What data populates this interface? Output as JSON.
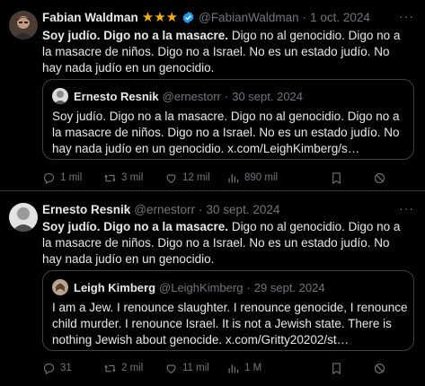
{
  "posts": [
    {
      "author_name": "Fabian Waldman",
      "stars": "★★★",
      "handle": "@FabianWaldman",
      "separator": "·",
      "date": "1 oct. 2024",
      "more": "···",
      "text_bold": "Soy judío. Digo no a la masacre.",
      "text_rest": " Digo no al genocidio. Digo no a la masacre de niños. Digo no a Israel. No es un estado judío. No hay nada judío en un genocidio.",
      "quote": {
        "author_name": "Ernesto Resnik",
        "handle": "@ernestorr",
        "separator": "·",
        "date": "30 sept. 2024",
        "text": "Soy judío. Digo no a la masacre. Digo no al genocidio. Digo no a la masacre de niños. Digo no a Israel. No es un estado judío. No hay nada judío en un genocidio. x.com/LeighKimberg/s…"
      },
      "actions": {
        "replies": "1 mil",
        "reposts": "3 mil",
        "likes": "12 mil",
        "views": "890 mil"
      }
    },
    {
      "author_name": "Ernesto Resnik",
      "handle": "@ernestorr",
      "separator": "·",
      "date": "30 sept. 2024",
      "more": "···",
      "text_bold": "Soy judío. Digo no a la masacre.",
      "text_rest": " Digo no al genocidio. Digo no a la masacre de niños. Digo no a Israel. No es un estado judío. No hay nada judío en un genocidio.",
      "quote": {
        "author_name": "Leigh Kimberg",
        "handle": "@LeighKimberg",
        "separator": "·",
        "date": "29 sept. 2024",
        "text": "I am a Jew. I renounce slaughter. I renounce genocide, I renounce child murder. I renounce Israel. It is not a Jewish state. There is nothing Jewish about genocide. x.com/Gritty20202/st…"
      },
      "actions": {
        "replies": "31",
        "reposts": "2 mil",
        "likes": "11 mil",
        "views": "1 M"
      }
    }
  ],
  "icons": [
    "reply-icon",
    "repost-icon",
    "like-icon",
    "views-icon",
    "bookmark-icon",
    "share-icon",
    "verified-icon"
  ],
  "colors": {
    "background": "#000000",
    "text": "#e7e9ea",
    "muted": "#71767b",
    "verified": "#1d9bf0",
    "stars": "#f5b000",
    "border": "#2f3336"
  }
}
